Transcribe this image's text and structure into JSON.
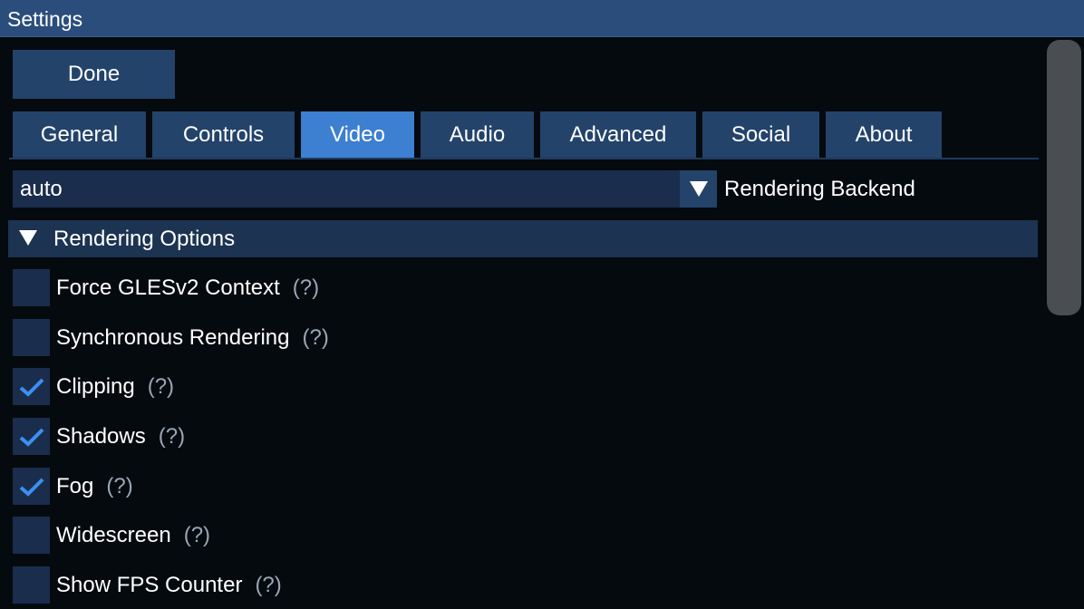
{
  "window": {
    "title": "Settings"
  },
  "done_label": "Done",
  "tabs": [
    {
      "label": "General",
      "active": false
    },
    {
      "label": "Controls",
      "active": false
    },
    {
      "label": "Video",
      "active": true
    },
    {
      "label": "Audio",
      "active": false
    },
    {
      "label": "Advanced",
      "active": false
    },
    {
      "label": "Social",
      "active": false
    },
    {
      "label": "About",
      "active": false
    }
  ],
  "backend": {
    "selected": "auto",
    "label": "Rendering Backend",
    "arrow_icon": "triangle-down-icon"
  },
  "section": {
    "label": "Rendering Options",
    "expanded": true,
    "icon": "triangle-down-icon"
  },
  "help_text": "(?)",
  "options": [
    {
      "label": "Force GLESv2 Context",
      "checked": false
    },
    {
      "label": "Synchronous Rendering",
      "checked": false
    },
    {
      "label": "Clipping",
      "checked": true
    },
    {
      "label": "Shadows",
      "checked": true
    },
    {
      "label": "Fog",
      "checked": true
    },
    {
      "label": "Widescreen",
      "checked": false
    },
    {
      "label": "Show FPS Counter",
      "checked": false
    }
  ],
  "colors": {
    "titlebar": "#2a4d7c",
    "tab": "#23436b",
    "tab_active": "#3d7fd0",
    "check": "#3d8ff0"
  }
}
